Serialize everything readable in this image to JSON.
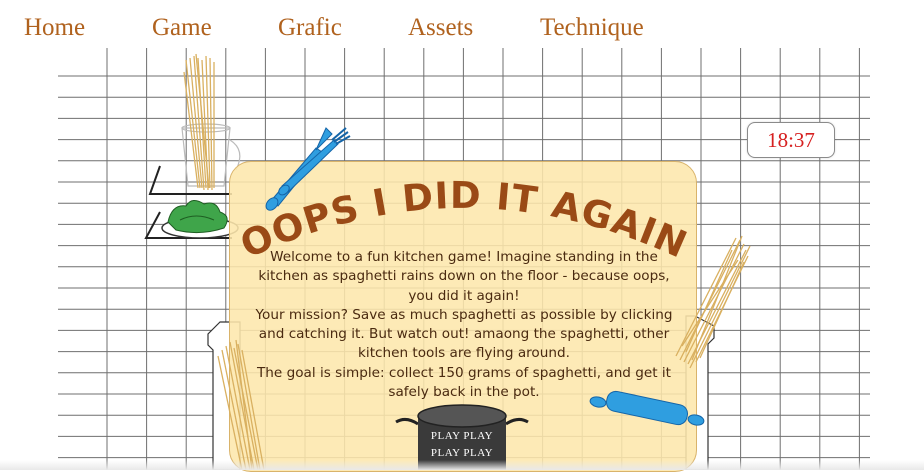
{
  "nav": {
    "items": [
      {
        "label": "Home"
      },
      {
        "label": "Game"
      },
      {
        "label": "Grafic"
      },
      {
        "label": "Assets"
      },
      {
        "label": "Technique"
      }
    ]
  },
  "timer": {
    "value": "18:37"
  },
  "game": {
    "title": "! OOPS I DID IT AGAIN !",
    "intro": [
      "Welcome to a fun kitchen game! Imagine standing in the kitchen as spaghetti rains down on the floor - because oops, you did it again!",
      "Your mission? Save as much spaghetti as possible by clicking and catching it. But watch out! amaong the spaghetti, other kitchen tools are flying around.",
      "The goal is simple: collect 150 grams of spaghetti, and get it safely back in the pot."
    ],
    "play_lines": [
      "PLAY PLAY",
      "PLAY PLAY"
    ]
  },
  "colors": {
    "nav_text": "#b0621e",
    "title": "#9a4a16",
    "panel": "#fde7ac",
    "timer_text": "#d62020",
    "pot": "#3a3a3a",
    "fork": "#2f9ee0",
    "rolling_pin": "#2f9ee0",
    "spaghetti": "#d9b060"
  },
  "icons": [
    "spaghetti-bundle-icon",
    "fork-icon",
    "lettuce-icon",
    "rolling-pin-icon",
    "cooking-pot-icon",
    "glass-jar-icon"
  ]
}
